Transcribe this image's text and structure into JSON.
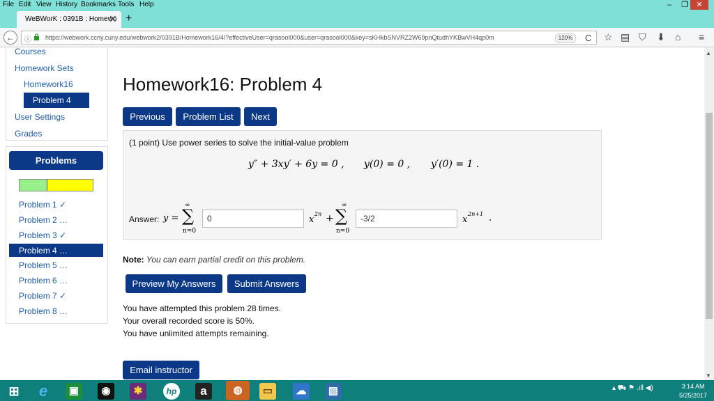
{
  "browser": {
    "menu": [
      "File",
      "Edit",
      "View",
      "History",
      "Bookmarks",
      "Tools",
      "Help"
    ],
    "window_controls": {
      "minimize": "–",
      "restore": "❐",
      "close": "✕"
    },
    "tab_title": "WeBWorK : 0391B : Homewo",
    "tab_close": "✕",
    "new_tab": "+",
    "back_glyph": "←",
    "info_glyph": "ⓘ",
    "lock_glyph": "🔒",
    "url": "https://webwork.ccny.cuny.edu/webwork2/0391B/Homework16/4/?effectiveUser=qrasool000&user=qrasool000&key=sKHkbSNVRZ2W69pnQtudhYKBwVH4qp0m",
    "zoom": "120%",
    "reload_glyph": "C",
    "toolbar_icons": [
      "star-icon",
      "reader-icon",
      "pocket-icon",
      "download-icon",
      "home-icon",
      "menu-icon"
    ],
    "toolbar_glyphs": {
      "star": "☆",
      "reader": "▤",
      "pocket": "⛉",
      "download": "⬇",
      "home": "⌂",
      "menu": "≡"
    }
  },
  "sidebar": {
    "courses": "Courses",
    "homework_sets": "Homework Sets",
    "homework16": "Homework16",
    "problem4": "Problem 4",
    "user_settings": "User Settings",
    "grades": "Grades",
    "problems_heading": "Problems",
    "progress": {
      "correct_fraction": 0.375
    },
    "problems": [
      {
        "label": "Problem 1 ✓"
      },
      {
        "label": "Problem 2 …"
      },
      {
        "label": "Problem 3 ✓"
      },
      {
        "label": "Problem 4 …"
      },
      {
        "label": "Problem 5 …"
      },
      {
        "label": "Problem 6 …"
      },
      {
        "label": "Problem 7 ✓"
      },
      {
        "label": "Problem 8 …"
      }
    ]
  },
  "main": {
    "title": "Homework16: Problem 4",
    "nav": {
      "previous": "Previous",
      "list": "Problem List",
      "next": "Next"
    },
    "intro": "(1 point) Use power series to solve the initial-value problem",
    "equation": {
      "ode": "y″ + 3xy′ + 6y = 0 ,",
      "ic1": "y(0) = 0 ,",
      "ic2": "y′(0) = 1 ."
    },
    "answer": {
      "label": "Answer: ",
      "y_eq": "y =",
      "sum_upper": "∞",
      "sum_lower": "n=0",
      "sigma": "∑",
      "value1": "0",
      "term1": "x",
      "exp1": "2n",
      "plus": "+",
      "value2": "-3/2",
      "term2": "x",
      "exp2": "2n+1",
      "period": "."
    },
    "note_label": "Note:",
    "note_text": "You can earn partial credit on this problem.",
    "buttons": {
      "preview": "Preview My Answers",
      "submit": "Submit Answers",
      "email": "Email instructor"
    },
    "status": [
      "You have attempted this problem 28 times.",
      "Your overall recorded score is 50%.",
      "You have unlimited attempts remaining."
    ]
  },
  "taskbar": {
    "apps": [
      {
        "name": "windows-start-icon",
        "glyph": "⊞"
      },
      {
        "name": "internet-explorer-icon",
        "glyph": "e"
      },
      {
        "name": "store-icon",
        "glyph": "▣"
      },
      {
        "name": "camera-app-icon",
        "glyph": "◉"
      },
      {
        "name": "paint-app-icon",
        "glyph": "✱"
      },
      {
        "name": "hp-app-icon",
        "glyph": "hp"
      },
      {
        "name": "amazon-icon",
        "glyph": "a"
      },
      {
        "name": "firefox-icon",
        "glyph": "◍"
      },
      {
        "name": "file-explorer-icon",
        "glyph": "▭"
      },
      {
        "name": "onedrive-icon",
        "glyph": "☁"
      },
      {
        "name": "photos-icon",
        "glyph": "▨"
      }
    ],
    "tray_glyphs": "▴  ⛟  ⚑  .ıll  ◀)",
    "time": "3:14 AM",
    "date": "5/25/2017"
  }
}
